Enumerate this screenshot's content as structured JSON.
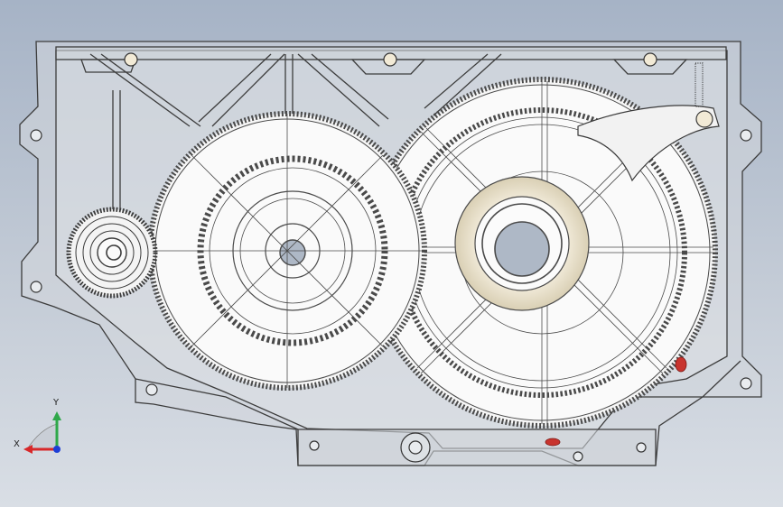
{
  "viewport": {
    "background_top": "#a6b3c6",
    "background_bottom": "#d9dee5"
  },
  "colors": {
    "housing_stroke": "#3c3c3c",
    "housing_fill": "#d6d9dc",
    "gear_fill": "#f7f7f7",
    "gear_stroke": "#4a4a4a",
    "bearing_ring": "#ebe4d2",
    "bore_fill": "#aeb8c6",
    "marker_red": "#c8342e",
    "axis_x": "#d8282a",
    "axis_y": "#2fa84a",
    "axis_z": "#1e3fd6"
  },
  "triad": {
    "x_label": "X",
    "y_label": "Y",
    "icon": "coordinate-triad-icon"
  }
}
